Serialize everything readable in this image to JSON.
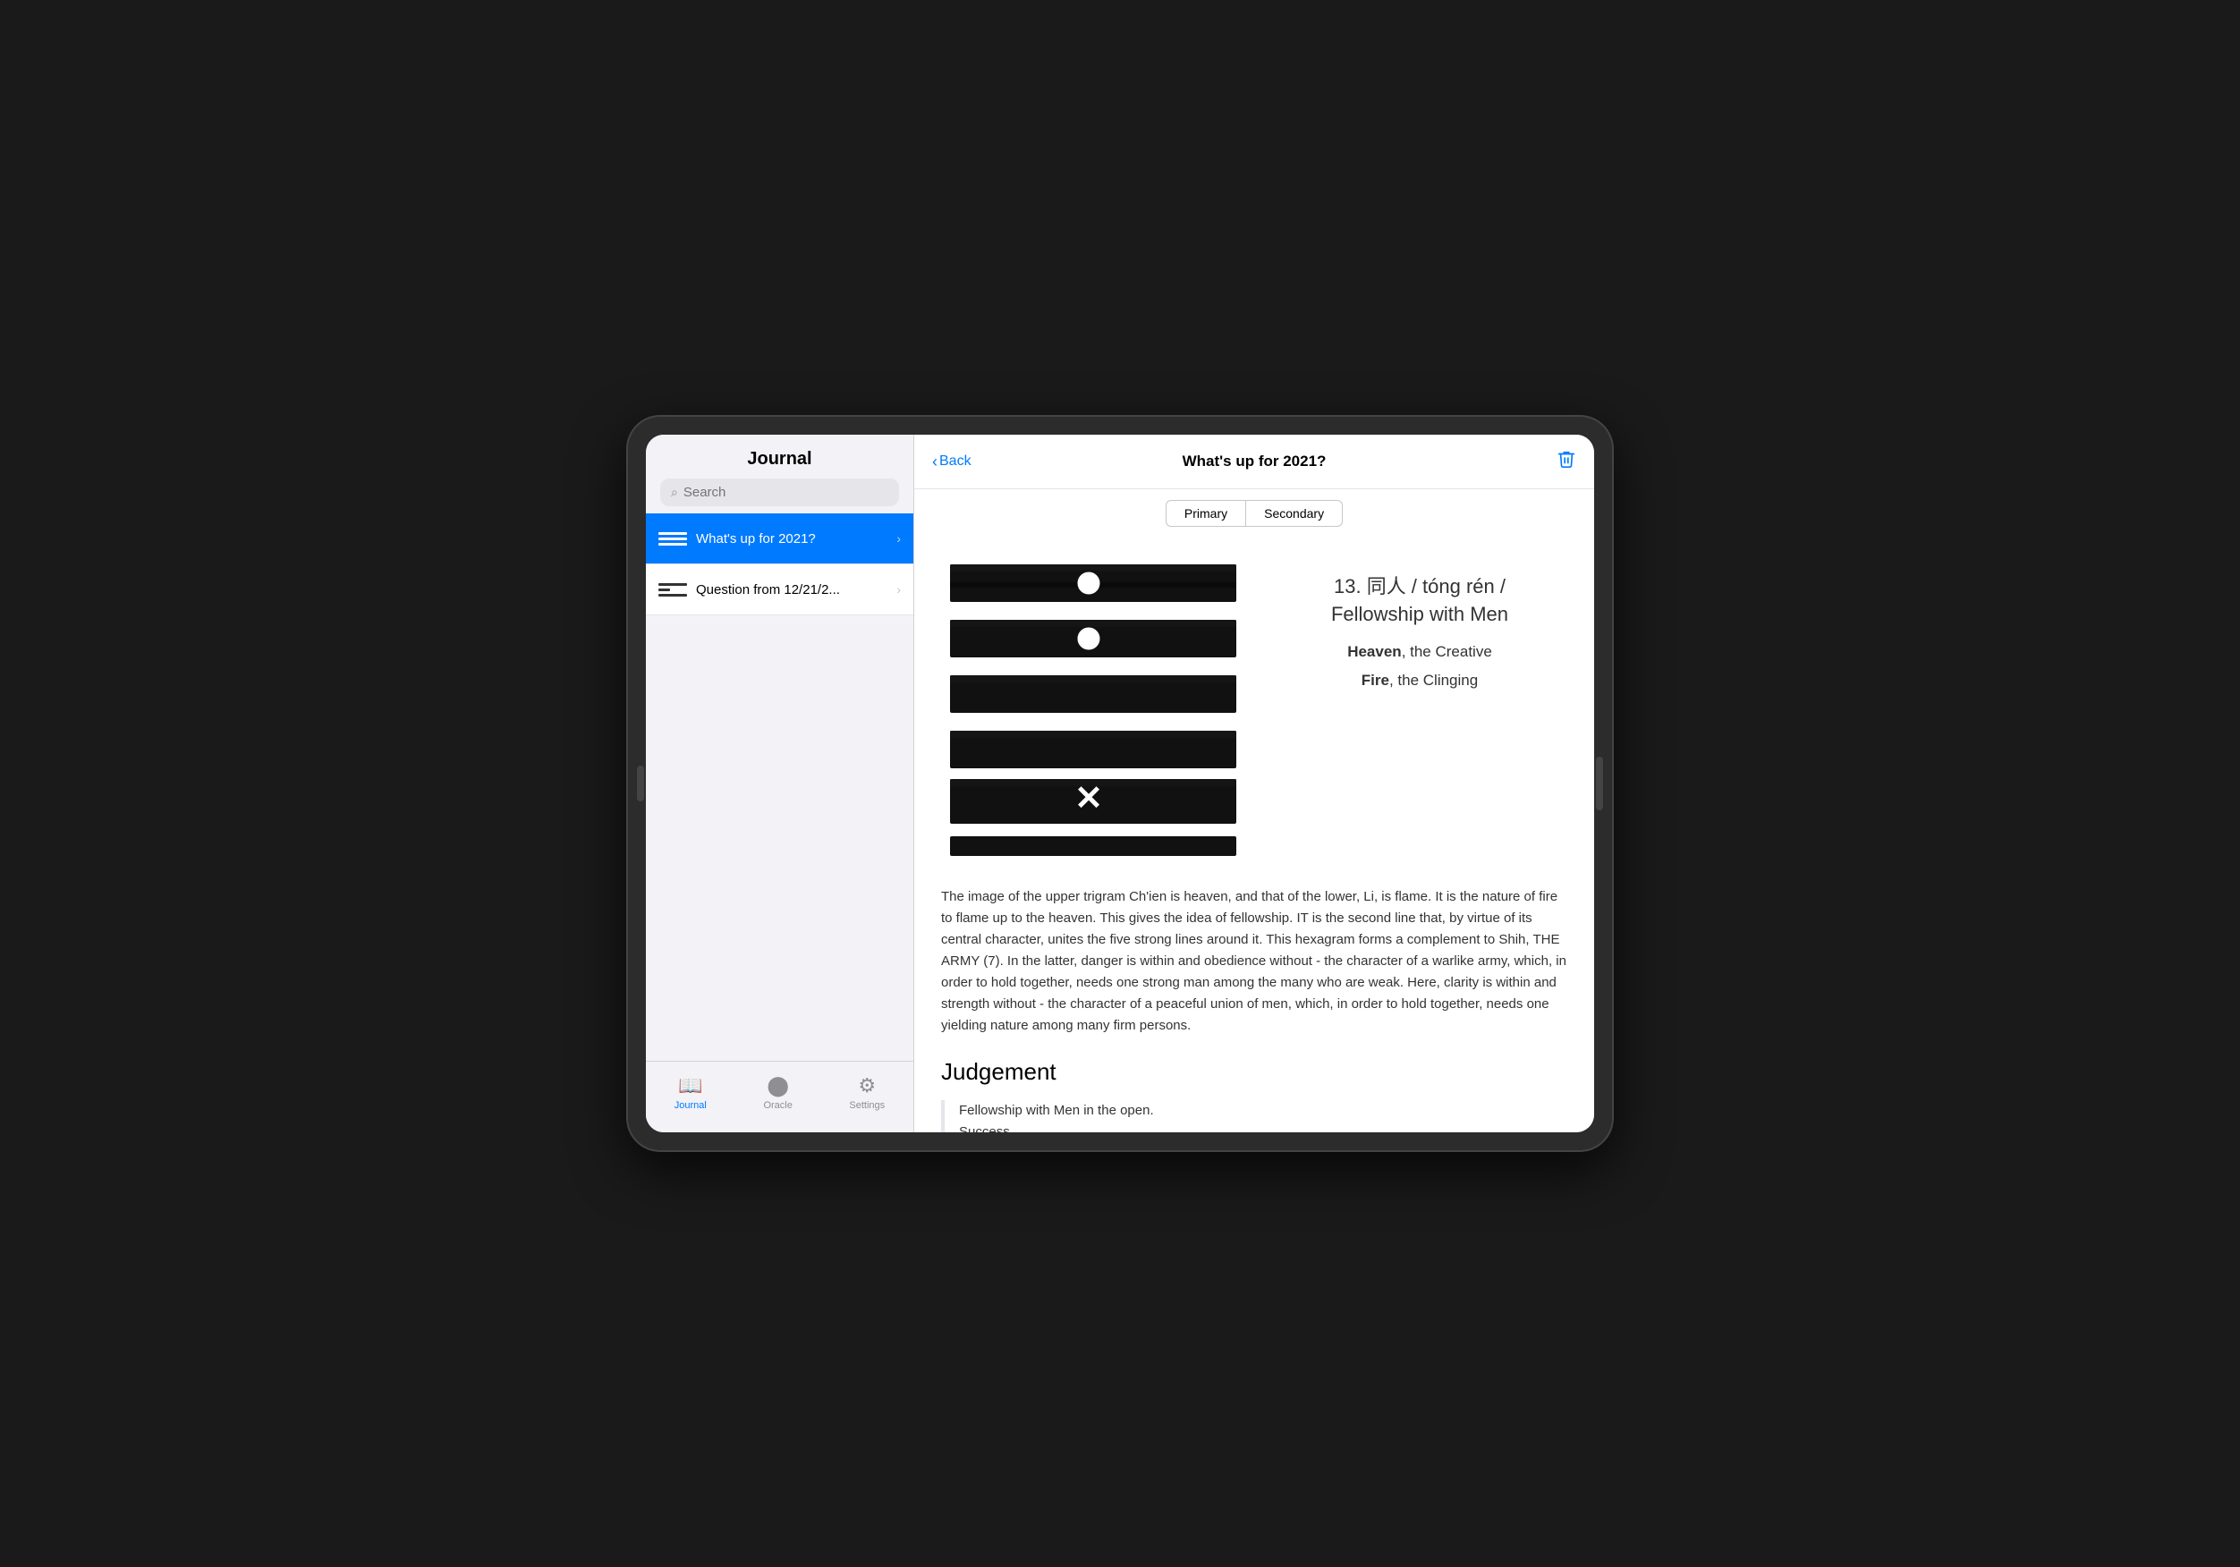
{
  "sidebar": {
    "title": "Journal",
    "search_placeholder": "Search",
    "items": [
      {
        "id": "item1",
        "title": "What's up for 2021?",
        "active": true
      },
      {
        "id": "item2",
        "title": "Question from 12/21/2...",
        "active": false
      }
    ]
  },
  "tabs": [
    {
      "id": "journal",
      "label": "Journal",
      "active": true,
      "icon": "book"
    },
    {
      "id": "oracle",
      "label": "Oracle",
      "active": false,
      "icon": "oracle"
    },
    {
      "id": "settings",
      "label": "Settings",
      "active": false,
      "icon": "settings"
    }
  ],
  "main": {
    "back_label": "Back",
    "title": "What's up for 2021?",
    "segment_primary": "Primary",
    "segment_secondary": "Secondary",
    "hexagram_number": "13. 同人 / tóng rén /",
    "hexagram_subtitle": "Fellowship with Men",
    "trigram1_name": "Heaven",
    "trigram1_desc": ", the Creative",
    "trigram2_name": "Fire",
    "trigram2_desc": ", the Clinging",
    "body_text": "The image of the upper trigram Ch'ien is heaven, and that of the lower, Li, is flame. It is the nature of fire to flame up to the heaven. This gives the idea of fellowship. IT is the second line that, by virtue of its central character, unites the five strong lines around it. This hexagram forms a complement to Shih, THE ARMY (7). In the latter, danger is within and obedience without - the character of a warlike army, which, in order to hold together, needs one strong man among the many who are weak. Here, clarity is within and strength without - the character of a peaceful union of men, which, in order to hold together, needs one yielding nature among many firm persons.",
    "judgement_title": "Judgement",
    "quote_line1": "Fellowship with Men in the open.",
    "quote_line2": "Success."
  }
}
